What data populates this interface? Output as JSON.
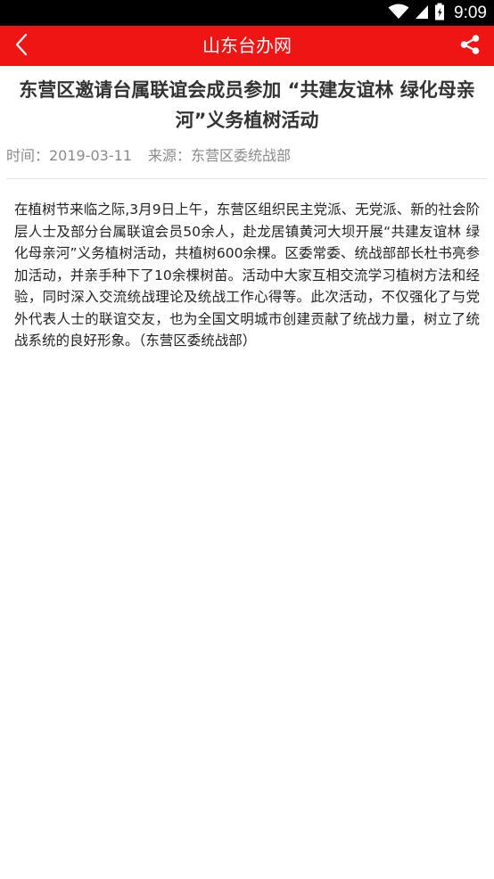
{
  "status_bar": {
    "time": "9:09",
    "icons": [
      "wifi-icon",
      "cell-signal-icon",
      "battery-icon"
    ]
  },
  "app_bar": {
    "title": "山东台办网",
    "back_icon": "chevron-left-icon",
    "share_icon": "share-icon",
    "background_color": "#ef1515"
  },
  "article": {
    "title": "东营区邀请台属联谊会成员参加 “共建友谊林 绿化母亲河”义务植树活动",
    "time_label": "时间：2019-03-11",
    "source_label": "来源：东营区委统战部",
    "body": "在植树节来临之际,3月9日上午，东营区组织民主党派、无党派、新的社会阶层人士及部分台属联谊会员50余人，赴龙居镇黄河大坝开展“共建友谊林 绿化母亲河”义务植树活动，共植树600余棵。区委常委、统战部部长杜书亮参加活动，并亲手种下了10余棵树苗。活动中大家互相交流学习植树方法和经验，同时深入交流统战理论及统战工作心得等。此次活动，不仅强化了与党外代表人士的联谊交友，也为全国文明城市创建贡献了统战力量，树立了统战系统的良好形象。（东营区委统战部）"
  }
}
